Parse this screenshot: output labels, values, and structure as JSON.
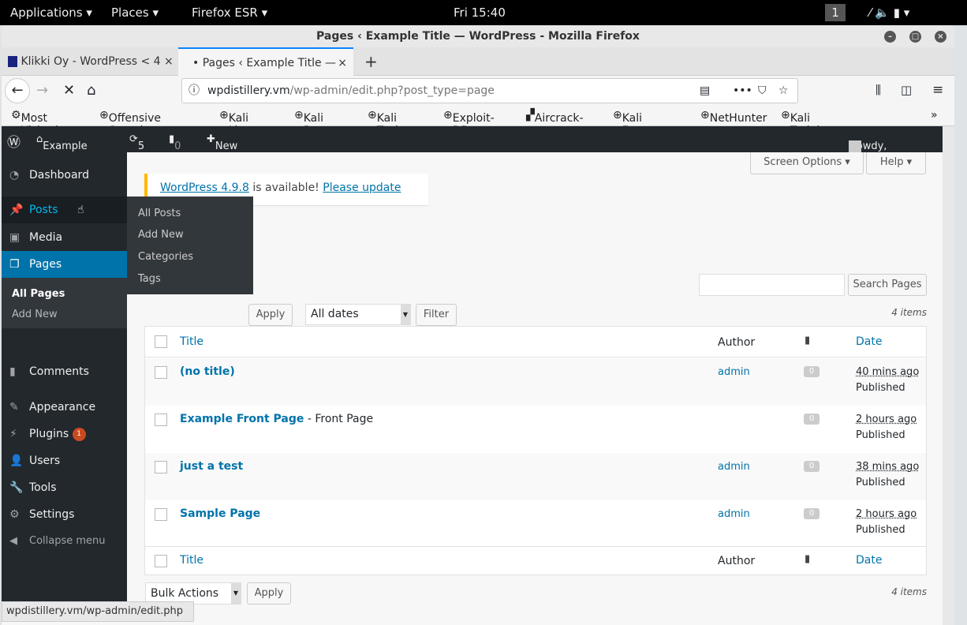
{
  "system": {
    "applications": "Applications ▾",
    "places": "Places ▾",
    "firefox": "Firefox ESR ▾",
    "clock": "Fri 15:40",
    "workspace": "1"
  },
  "window": {
    "title": "Pages ‹ Example Title — WordPress - Mozilla Firefox"
  },
  "tabs": [
    {
      "label": "Klikki Oy - WordPress < 4"
    },
    {
      "label": "• Pages ‹ Example Title —"
    }
  ],
  "url": {
    "host": "wpdistillery.vm",
    "path": "/wp-admin/edit.php?post_type=page"
  },
  "bookmarks": [
    "Most Visited",
    "Offensive Security",
    "Kali Linux",
    "Kali Docs",
    "Kali Tools",
    "Exploit-DB",
    "Aircrack-ng",
    "Kali Forums",
    "NetHunter",
    "Kali Training"
  ],
  "adminbar": {
    "site": "Example Title",
    "updates": "5",
    "comments": "0",
    "new": "New",
    "howdy": "Howdy, admin"
  },
  "sidebar": {
    "items": [
      {
        "label": "Dashboard"
      },
      {
        "label": "Posts"
      },
      {
        "label": "Media"
      },
      {
        "label": "Pages"
      },
      {
        "label": "Comments"
      },
      {
        "label": "Appearance"
      },
      {
        "label": "Plugins",
        "badge": "1"
      },
      {
        "label": "Users"
      },
      {
        "label": "Tools"
      },
      {
        "label": "Settings"
      }
    ],
    "submenu": [
      "All Pages",
      "Add New"
    ],
    "collapse": "Collapse menu"
  },
  "flyout": [
    "All Posts",
    "Add New",
    "Categories",
    "Tags"
  ],
  "notice": {
    "version_link": "WordPress 4.9.8",
    "text": " is available! ",
    "update_link": "Please update now",
    "end": "."
  },
  "screen_options": "Screen Options ▾",
  "help": "Help ▾",
  "search_button": "Search Pages",
  "filters": {
    "apply": "Apply",
    "dates": "All dates",
    "filter": "Filter",
    "count": "4 items",
    "bulk": "Bulk Actions"
  },
  "table": {
    "headers": {
      "title": "Title",
      "author": "Author",
      "date": "Date"
    },
    "rows": [
      {
        "title": "(no title)",
        "suffix": "",
        "author": "admin",
        "comments": "0",
        "date": "40 mins ago",
        "status": "Published"
      },
      {
        "title": "Example Front Page",
        "suffix": " - Front Page",
        "author": "",
        "comments": "0",
        "date": "2 hours ago",
        "status": "Published"
      },
      {
        "title": "just a test",
        "suffix": "",
        "author": "admin",
        "comments": "0",
        "date": "38 mins ago",
        "status": "Published"
      },
      {
        "title": "Sample Page",
        "suffix": "",
        "author": "admin",
        "comments": "0",
        "date": "2 hours ago",
        "status": "Published"
      }
    ]
  },
  "statusbar": "wpdistillery.vm/wp-admin/edit.php"
}
